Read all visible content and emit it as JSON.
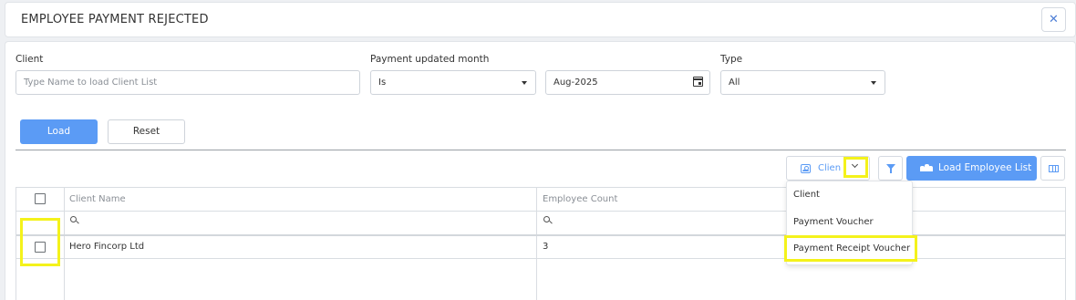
{
  "dialog": {
    "title": "EMPLOYEE PAYMENT REJECTED",
    "close_symbol": "✕"
  },
  "filters": {
    "client": {
      "label": "Client",
      "placeholder": "Type Name to load Client List",
      "value": ""
    },
    "payment_month": {
      "label": "Payment updated month",
      "operator": "Is",
      "value": "Aug-2025"
    },
    "type": {
      "label": "Type",
      "value": "All"
    }
  },
  "actions": {
    "load_label": "Load",
    "reset_label": "Reset"
  },
  "toolbar": {
    "group_by_label": "Clien",
    "load_employee_list_label": "Load Employee List"
  },
  "dropdown_menu": {
    "items": [
      "Client",
      "Payment Voucher",
      "Payment Receipt Voucher"
    ]
  },
  "grid": {
    "columns": [
      "Client Name",
      "Employee Count"
    ],
    "rows": [
      {
        "client_name": "Hero Fincorp Ltd",
        "employee_count": "3"
      }
    ]
  },
  "colors": {
    "accent": "#5b9bf5",
    "highlight": "#f4f21b"
  }
}
